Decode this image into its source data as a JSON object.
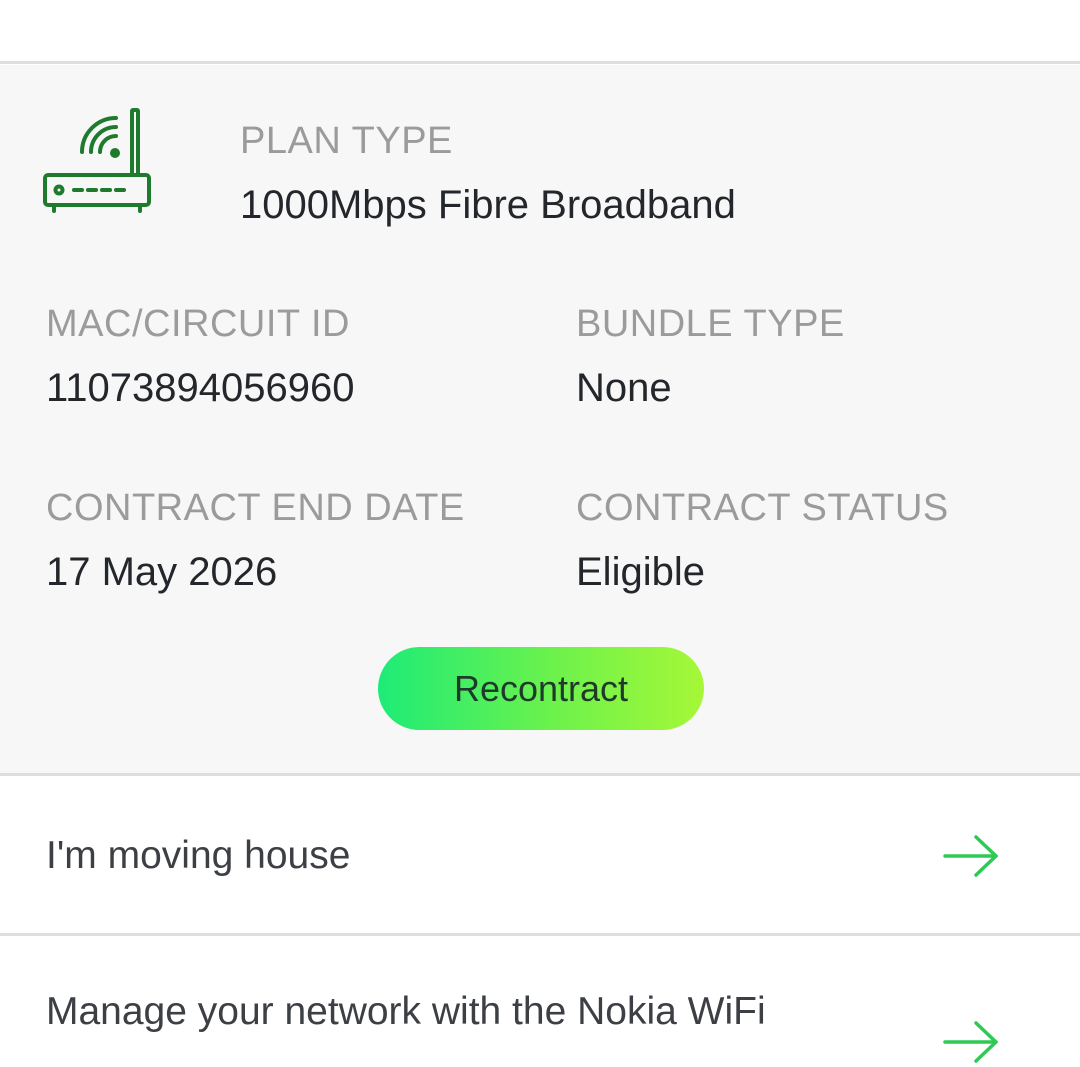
{
  "plan": {
    "icon": "wifi-router-icon",
    "type_label": "PLAN TYPE",
    "type_value": "1000Mbps Fibre Broadband"
  },
  "details": {
    "mac_label": "MAC/CIRCUIT ID",
    "mac_value": "11073894056960",
    "bundle_label": "BUNDLE TYPE",
    "bundle_value": "None",
    "contract_end_label": "CONTRACT END DATE",
    "contract_end_value": "17 May 2026",
    "contract_status_label": "CONTRACT STATUS",
    "contract_status_value": "Eligible"
  },
  "actions": {
    "recontract_label": "Recontract"
  },
  "links": [
    {
      "label": "I'm moving house",
      "icon": "arrow-right-icon"
    },
    {
      "label": "Manage your network with the Nokia WiFi",
      "icon": "arrow-right-icon"
    }
  ],
  "colors": {
    "accent_green": "#2fca56",
    "icon_green": "#1f7a2e",
    "button_gradient_start": "#1eeb77",
    "button_gradient_end": "#a6f737"
  }
}
